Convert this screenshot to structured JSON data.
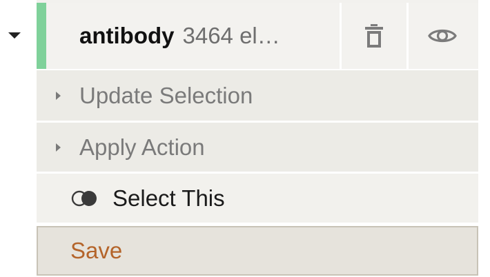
{
  "group": {
    "name": "antibody",
    "count_text": "3464 el…",
    "accent_color": "#7fd19a",
    "delete_icon": "trash-icon",
    "visibility_icon": "eye-icon"
  },
  "menu": {
    "update_selection_label": "Update Selection",
    "apply_action_label": "Apply Action",
    "select_this_label": "Select This",
    "select_icon": "venn-overlap-icon"
  },
  "save": {
    "label": "Save",
    "text_color": "#b4642a"
  }
}
